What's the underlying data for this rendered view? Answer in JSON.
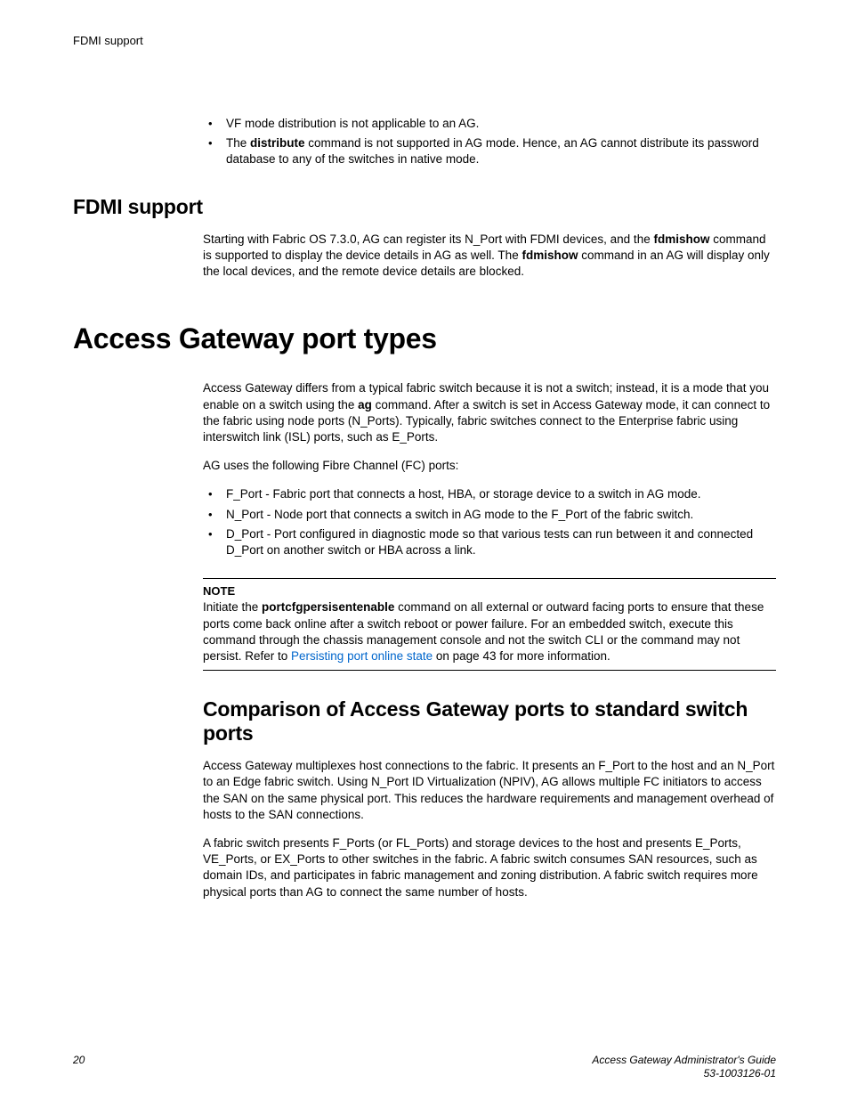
{
  "header": {
    "running": "FDMI support"
  },
  "top_list": {
    "item1": "VF mode distribution is not applicable to an AG.",
    "item2_pre": "The ",
    "item2_cmd": "distribute",
    "item2_post": " command is not supported in AG mode. Hence, an AG cannot distribute its password database to any of the switches in native mode."
  },
  "fdmi": {
    "title": "FDMI support",
    "para_pre": "Starting with Fabric OS 7.3.0, AG can register its N_Port with FDMI devices, and the ",
    "cmd1": "fdmishow",
    "para_mid": " command is supported to display the device details in AG as well. The ",
    "cmd2": "fdmishow",
    "para_post": " command in an AG will display only the local devices, and the remote device details are blocked."
  },
  "porttypes": {
    "title": "Access Gateway port types",
    "para1_pre": "Access Gateway differs from a typical fabric switch because it is not a switch; instead, it is a mode that you enable on a switch using the ",
    "para1_cmd": "ag",
    "para1_post": " command. After a switch is set in Access Gateway mode, it can connect to the fabric using node ports (N_Ports). Typically, fabric switches connect to the Enterprise fabric using interswitch link (ISL) ports, such as E_Ports.",
    "para2": "AG uses the following Fibre Channel (FC) ports:",
    "list": {
      "i1": "F_Port - Fabric port that connects a host, HBA, or storage device to a switch in AG mode.",
      "i2": "N_Port - Node port that connects a switch in AG mode to the F_Port of the fabric switch.",
      "i3": "D_Port - Port configured in diagnostic mode so that various tests can run between it and connected D_Port on another switch or HBA across a link."
    },
    "note": {
      "label": "NOTE",
      "pre": "Initiate the ",
      "cmd": "portcfgpersisentenable",
      "mid": " command on all external or outward facing ports to ensure that these ports come back online after a switch reboot or power failure. For an embedded switch, execute this command through the chassis management console and not the switch CLI or the command may not persist. Refer to ",
      "link": "Persisting port online state",
      "post": " on page 43 for more information."
    }
  },
  "comparison": {
    "title": "Comparison of Access Gateway ports to standard switch ports",
    "para1": "Access Gateway multiplexes host connections to the fabric. It presents an F_Port to the host and an N_Port to an Edge fabric switch. Using N_Port ID Virtualization (NPIV), AG allows multiple FC initiators to access the SAN on the same physical port. This reduces the hardware requirements and management overhead of hosts to the SAN connections.",
    "para2": "A fabric switch presents F_Ports (or FL_Ports) and storage devices to the host and presents E_Ports, VE_Ports, or EX_Ports to other switches in the fabric. A fabric switch consumes SAN resources, such as domain IDs, and participates in fabric management and zoning distribution. A fabric switch requires more physical ports than AG to connect the same number of hosts."
  },
  "footer": {
    "page": "20",
    "doc": "Access Gateway Administrator's Guide",
    "docnum": "53-1003126-01"
  }
}
